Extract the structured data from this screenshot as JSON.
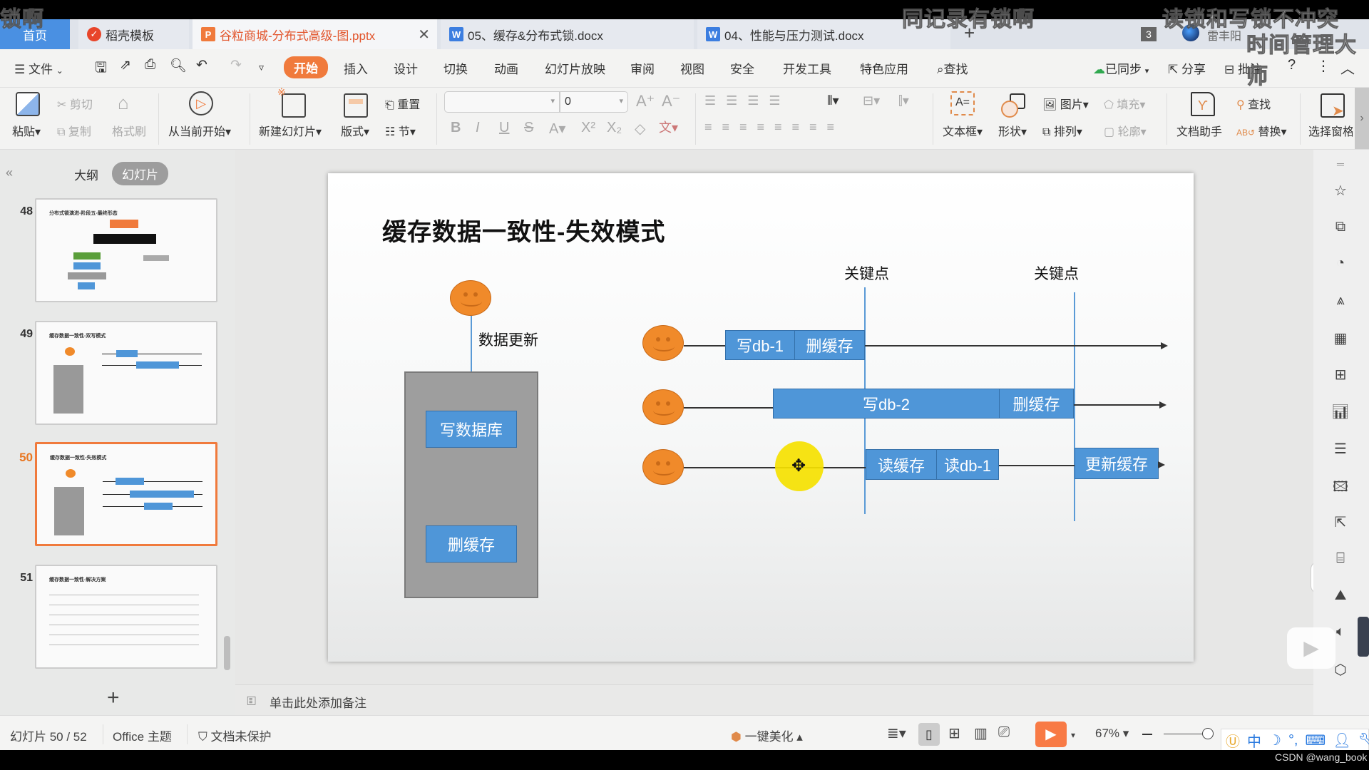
{
  "overlays": {
    "top_left": "锁啊",
    "top_center": "同记录有锁啊",
    "top_right_1": "读锁和写锁不冲突",
    "top_right_2": "时间管理大师",
    "watermark": "CSDN @wang_book"
  },
  "tabs": [
    {
      "label": "首页",
      "icon": "home"
    },
    {
      "label": "稻壳模板",
      "icon": "docer-logo"
    },
    {
      "label": "谷粒商城-分布式高级-图.pptx",
      "icon": "P",
      "active": true
    },
    {
      "label": "05、缓存&分布式锁.docx",
      "icon": "W"
    },
    {
      "label": "04、性能与压力测试.docx",
      "icon": "W"
    }
  ],
  "tabbar": {
    "add": "+",
    "window_count": "3",
    "user_name": "雷丰阳"
  },
  "menu": {
    "file": "文件",
    "items": [
      "开始",
      "插入",
      "设计",
      "切换",
      "动画",
      "幻灯片放映",
      "审阅",
      "视图",
      "安全",
      "开发工具",
      "特色应用"
    ],
    "active": "开始",
    "search": "查找",
    "sync": "已同步",
    "share": "分享",
    "comment": "批注"
  },
  "ribbon": {
    "paste": "粘贴",
    "cut": "剪切",
    "copy": "复制",
    "format_painter": "格式刷",
    "from_current": "从当前开始",
    "new_slide": "新建幻灯片",
    "layout": "版式",
    "reset": "重置",
    "section": "节",
    "font_name": "",
    "font_size": "0",
    "textbox": "文本框",
    "shape": "形状",
    "picture": "图片",
    "arrange": "排列",
    "fill": "填充",
    "outline": "轮廓",
    "doc_assistant": "文档助手",
    "find": "查找",
    "replace": "替换",
    "select_pane": "选择窗格"
  },
  "panel": {
    "tab_outline": "大纲",
    "tab_slides": "幻灯片",
    "active_tab": "幻灯片",
    "slides": [
      {
        "num": "48",
        "title": "分布式锁演进-阶段五-最终形态"
      },
      {
        "num": "49",
        "title": "缓存数据一致性-双写模式"
      },
      {
        "num": "50",
        "title": "缓存数据一致性-失效模式",
        "selected": true
      },
      {
        "num": "51",
        "title": "缓存数据一致性-解决方案"
      }
    ],
    "add_slide": "+"
  },
  "slide": {
    "title": "缓存数据一致性-失效模式",
    "data_update_label": "数据更新",
    "db_write": "写数据库",
    "db_delete_cache": "删缓存",
    "key_point_1": "关键点",
    "key_point_2": "关键点",
    "row1": [
      "写db-1",
      "删缓存"
    ],
    "row2": [
      "写db-2",
      "删缓存"
    ],
    "row3": [
      "读缓存",
      "读db-1",
      "更新缓存"
    ]
  },
  "notes_placeholder": "单击此处添加备注",
  "status": {
    "slide_counter": "幻灯片 50 / 52",
    "theme": "Office 主题",
    "protection": "文档未保护",
    "beautify": "一键美化",
    "zoom": "67%"
  },
  "ime": {
    "lang": "中"
  },
  "colors": {
    "accent_orange": "#f07a3c",
    "box_blue": "#4f96d8",
    "face_orange": "#f08a2a",
    "home_tab_blue": "#4a90e2"
  }
}
